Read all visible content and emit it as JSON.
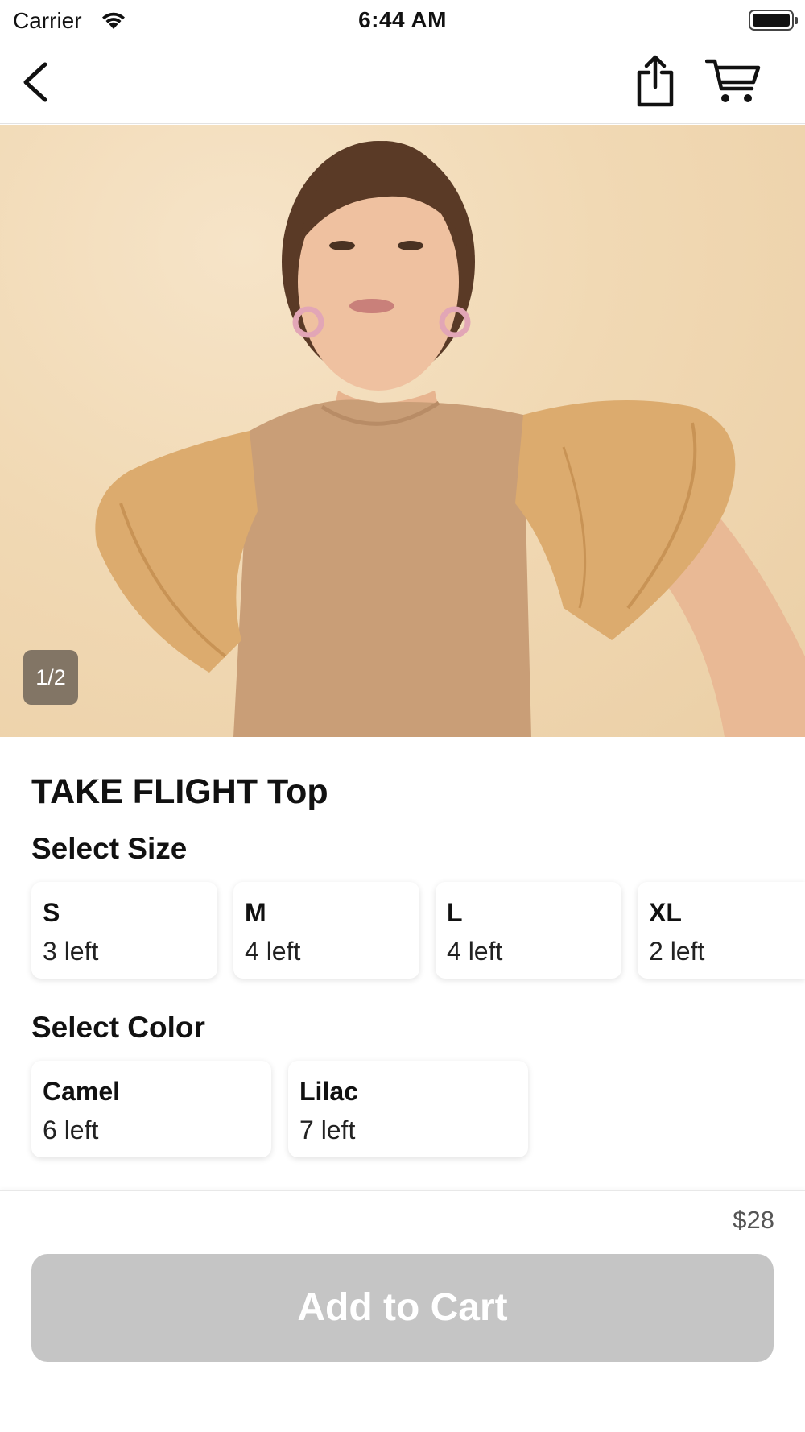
{
  "status_bar": {
    "carrier": "Carrier",
    "time": "6:44 AM",
    "wifi_icon": "wifi-icon",
    "battery_icon": "battery-icon"
  },
  "nav": {
    "back_icon": "chevron-left-icon",
    "share_icon": "share-icon",
    "cart_icon": "cart-icon"
  },
  "gallery": {
    "page_indicator": "1/2",
    "current_page": 1,
    "total_pages": 2
  },
  "product": {
    "title": "TAKE FLIGHT Top",
    "size_section_label": "Select Size",
    "sizes": [
      {
        "name": "S",
        "stock": "3 left"
      },
      {
        "name": "M",
        "stock": "4 left"
      },
      {
        "name": "L",
        "stock": "4 left"
      },
      {
        "name": "XL",
        "stock": "2 left"
      }
    ],
    "color_section_label": "Select Color",
    "colors": [
      {
        "name": "Camel",
        "stock": "6 left"
      },
      {
        "name": "Lilac",
        "stock": "7 left"
      }
    ]
  },
  "footer": {
    "price": "$28",
    "add_to_cart_label": "Add to Cart",
    "add_to_cart_color": "#c5c5c5"
  }
}
